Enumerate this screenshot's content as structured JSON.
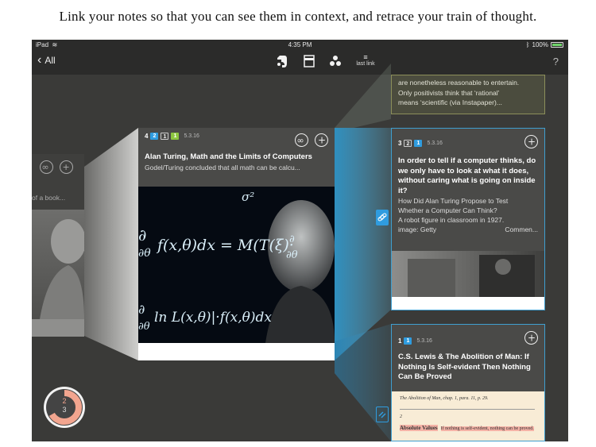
{
  "caption": "Link your notes so that you can see them in context, and retrace your train of thought.",
  "status": {
    "device": "iPad",
    "time": "4:35 PM",
    "battery": "100%"
  },
  "nav": {
    "back_label": "All",
    "last_link_label": "last link",
    "help": "?"
  },
  "top_note": {
    "lines": [
      "are nonetheless reasonable to entertain.",
      "Only positivists think that ‘rational’",
      "means ‘scientific    (via Instapaper)..."
    ]
  },
  "left_ghost": {
    "snippet": "of a book..."
  },
  "center_card": {
    "number": "4",
    "badge1": "2",
    "badge2": "1",
    "badge3": "1",
    "date": "5.3.16",
    "title": "Alan Turing, Math and the Limits of Computers",
    "snippet": "Godel/Turing concluded that all math can be calcu..."
  },
  "right_card_top": {
    "number": "3",
    "badge1": "2",
    "badge2": "1",
    "date": "5.3.16",
    "title": "In order to tell if a computer thinks, do we only have to look at what it does, without caring what is going on inside it?",
    "snippet_lines": [
      "How Did Alan Turing Propose to Test",
      "Whether a Computer Can Think?",
      "A robot figure in classroom in 1927."
    ],
    "image_credit": "image: Getty",
    "comment": "Commen..."
  },
  "right_card_bottom": {
    "number": "1",
    "badge1": "1",
    "date": "5.3.16",
    "title": "C.S. Lewis & The Abolition of Man: If Nothing Is Self-evident Then Nothing Can Be Proved",
    "doc_header": "The Abolition of Man, chap. 1, para. 11, p. 29.",
    "doc_number": "2",
    "doc_heading": "Absolute Values",
    "doc_line": "If nothing is self-evident, nothing can be proved."
  },
  "counter": {
    "top": "2",
    "bottom": "3",
    "progress": 0.667
  },
  "colors": {
    "accent_blue": "#2f9cdf",
    "salmon": "#f2a58f",
    "counter_bg": "#444"
  }
}
